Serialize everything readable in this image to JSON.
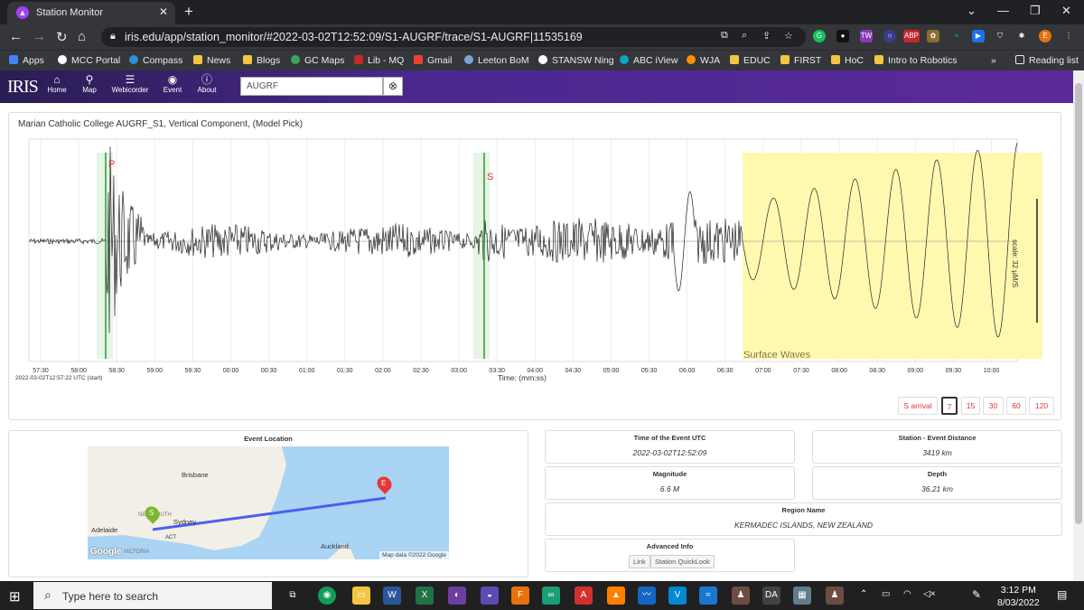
{
  "browser": {
    "tab_title": "Station Monitor",
    "url": "iris.edu/app/station_monitor/#2022-03-02T12:52:09/S1-AUGRF/trace/S1-AUGRF|11535169"
  },
  "bookmarks": [
    "Apps",
    "MCC Portal",
    "Compass",
    "News",
    "Blogs",
    "GC Maps",
    "Lib - MQ",
    "Gmail",
    "Leeton BoM",
    "STANSW Ning",
    "ABC iView",
    "WJA",
    "EDUC",
    "FIRST",
    "HoC",
    "Intro to Robotics"
  ],
  "reading_list": "Reading list",
  "iris": {
    "logo": "IRIS",
    "nav": [
      "Home",
      "Map",
      "Webicorder",
      "Event",
      "About"
    ],
    "search_value": "AUGRF"
  },
  "seismogram": {
    "title": "Marian Catholic College AUGRF_S1, Vertical Component, (Model Pick)",
    "p_label": "P",
    "s_label": "S",
    "surface_label": "Surface Waves",
    "time_ticks": [
      "57:30",
      "58:00",
      "58:30",
      "59:00",
      "59:30",
      "00:00",
      "00:30",
      "01:00",
      "01:30",
      "02:00",
      "02:30",
      "03:00",
      "03:30",
      "04:00",
      "04:30",
      "05:00",
      "05:30",
      "06:00",
      "06:30",
      "07:00",
      "07:30",
      "08:00",
      "08:30",
      "09:00",
      "09:30",
      "10:00"
    ],
    "time_axis_label": "Time: (mm:ss)",
    "start_label": "2022-03-02T12:57:22 UTC (start)",
    "scale_label": "scale: 32 µM/S",
    "buttons": [
      "S arrival",
      "7",
      "15",
      "30",
      "60",
      "120"
    ],
    "selected_button": "7"
  },
  "event": {
    "location_header": "Event Location",
    "map_labels": [
      "Brisbane",
      "Sydney",
      "Adelaide",
      "Auckland",
      "ACT",
      "VICTORIA",
      "NEW SOUTH"
    ],
    "station_pin": "S",
    "event_pin": "E",
    "map_data": "Map data ©2022 Google",
    "google": "Google",
    "time_header": "Time of the Event UTC",
    "time_value": "2022-03-02T12:52:09",
    "distance_header": "Station - Event Distance",
    "distance_value": "3419 km",
    "magnitude_header": "Magnitude",
    "magnitude_value": "6.6 M",
    "depth_header": "Depth",
    "depth_value": "36.21 km",
    "region_header": "Region Name",
    "region_value": "KERMADEC ISLANDS, NEW ZEALAND",
    "advanced_header": "Advanced Info",
    "link_label": "Link",
    "quicklook_label": "Station QuickLook"
  },
  "taskbar": {
    "search_placeholder": "Type here to search",
    "time": "3:12 PM",
    "date": "8/03/2022"
  },
  "colors": {
    "accent": "#4b2890",
    "pick_green": "#2a9d2a",
    "surface_yellow": "#fff9b0"
  }
}
